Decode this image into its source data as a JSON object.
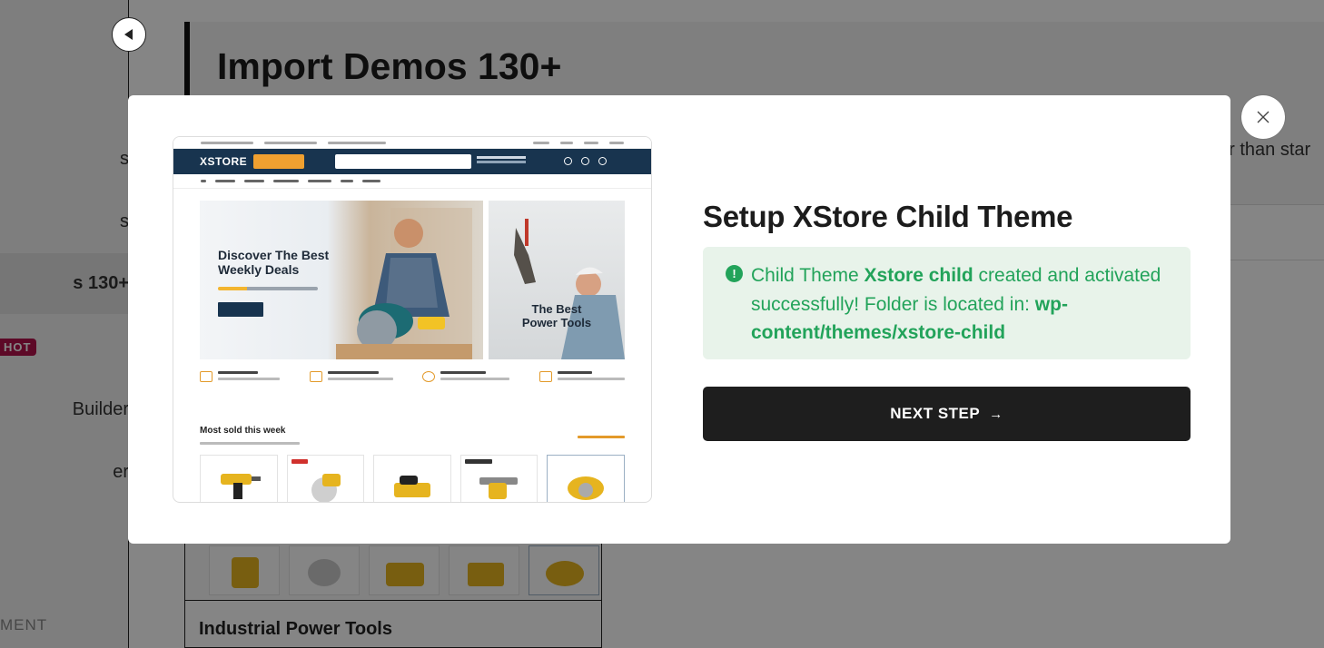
{
  "background": {
    "sidebar": {
      "items": [
        {
          "label": "s"
        },
        {
          "label": "s"
        },
        {
          "label": "s 130+"
        },
        {
          "label": "Builder"
        },
        {
          "label": "er"
        }
      ],
      "hot_badge": "HOT",
      "section_label": "MENT"
    },
    "header": {
      "title": "Import Demos 130+"
    },
    "right_panel_text": "er than star",
    "card": {
      "title": "Industrial Power Tools"
    }
  },
  "modal": {
    "preview": {
      "logo": "XSTORE",
      "hero_main_text": "Discover The Best Weekly Deals",
      "hero_side_text": "The Best Power Tools",
      "section_title": "Most sold this week"
    },
    "title": "Setup XStore Child Theme",
    "success": {
      "prefix": "Child Theme ",
      "theme_name": "Xstore child",
      "middle": " created and activated successfully! Folder is located in: ",
      "path": "wp-content/themes/xstore-child",
      "icon": "exclamation-circle-icon",
      "color": "#22a35a"
    },
    "next_button": {
      "label": "NEXT STEP",
      "arrow": "→"
    },
    "close_icon": "close-icon"
  },
  "colors": {
    "overlay": "#000000",
    "button_bg": "#1e1e1e",
    "success_bg": "#e8f3ea",
    "hot_badge": "#b3124b"
  }
}
